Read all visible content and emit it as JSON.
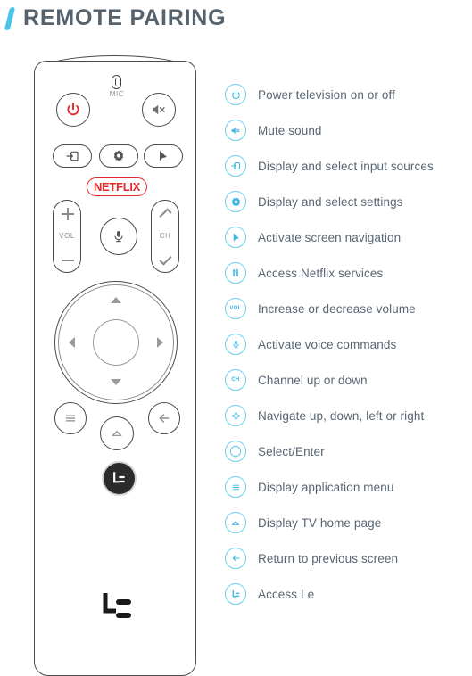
{
  "header": {
    "title": "REMOTE PAIRING",
    "accent_color": "#4cc3ea",
    "title_color": "#56626c",
    "slash_icon": "slash-accent-icon"
  },
  "remote": {
    "mic_indicator_label": "MIC",
    "mic_indicator_icon": "mic-hole-icon",
    "netflix_label": "NETFLIX",
    "netflix_color": "#e22b2b",
    "vol_label": "VOL",
    "ch_label": "CH",
    "power_color": "#e22b2b",
    "buttons": [
      {
        "name": "power-button",
        "icon": "power-icon"
      },
      {
        "name": "mute-button",
        "icon": "mute-speaker-icon"
      },
      {
        "name": "input-source-button",
        "icon": "input-source-icon"
      },
      {
        "name": "settings-button",
        "icon": "gear-icon"
      },
      {
        "name": "pointer-button",
        "icon": "cursor-pointer-icon"
      },
      {
        "name": "netflix-button",
        "icon": "netflix-wordmark-icon"
      },
      {
        "name": "volume-rocker",
        "icon": "plus-minus-icon"
      },
      {
        "name": "voice-button",
        "icon": "microphone-icon"
      },
      {
        "name": "channel-rocker",
        "icon": "chevron-up-down-icon"
      },
      {
        "name": "dpad",
        "icon": "dpad-arrows-icon"
      },
      {
        "name": "select-enter-button",
        "icon": "circle-select-icon"
      },
      {
        "name": "menu-button",
        "icon": "hamburger-menu-icon"
      },
      {
        "name": "home-button",
        "icon": "home-icon"
      },
      {
        "name": "back-button",
        "icon": "arrow-left-icon"
      },
      {
        "name": "le-button",
        "icon": "le-logo-icon"
      }
    ],
    "brand_logo_icon": "le-brand-logo-icon"
  },
  "legend": {
    "icon_border_color": "#72cdec",
    "icon_glyph_color": "#3cb4e5",
    "label_color": "#596673",
    "items": [
      {
        "icon": "power-icon",
        "label": "Power television on or off"
      },
      {
        "icon": "mute-speaker-icon",
        "label": "Mute sound"
      },
      {
        "icon": "input-source-icon",
        "label": "Display and select input sources"
      },
      {
        "icon": "gear-icon",
        "label": "Display and select settings"
      },
      {
        "icon": "cursor-pointer-icon",
        "label": "Activate screen navigation"
      },
      {
        "icon": "netflix-n-icon",
        "label": "Access Netflix services"
      },
      {
        "icon": "volume-icon",
        "label": "Increase or decrease volume",
        "mini": "VOL"
      },
      {
        "icon": "microphone-icon",
        "label": "Activate voice commands"
      },
      {
        "icon": "channel-icon",
        "label": "Channel up or down",
        "mini": "CH"
      },
      {
        "icon": "dpad-arrows-icon",
        "label": "Navigate up, down, left or right"
      },
      {
        "icon": "circle-select-icon",
        "label": "Select/Enter"
      },
      {
        "icon": "hamburger-menu-icon",
        "label": "Display application menu"
      },
      {
        "icon": "home-icon",
        "label": "Display TV home page"
      },
      {
        "icon": "arrow-left-icon",
        "label": "Return to previous screen"
      },
      {
        "icon": "le-logo-icon",
        "label": "Access Le"
      }
    ]
  }
}
